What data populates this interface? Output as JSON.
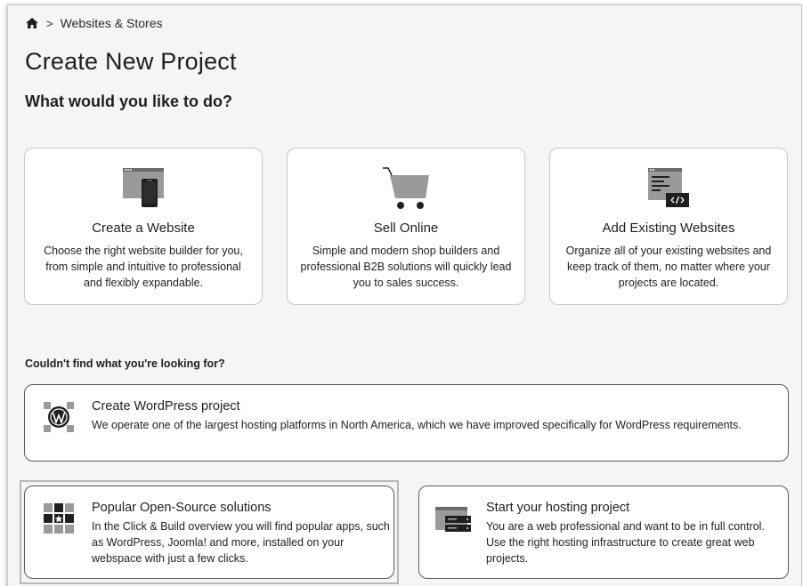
{
  "breadcrumb": {
    "home_icon": "home-icon",
    "separator": ">",
    "current": "Websites & Stores"
  },
  "page_title": "Create New Project",
  "subtitle": "What would you like to do?",
  "cards": [
    {
      "icon": "website-device-icon",
      "title": "Create a Website",
      "description": "Choose the right website builder for you, from simple and intuitive to professional and flexibly expandable."
    },
    {
      "icon": "shopping-cart-icon",
      "title": "Sell Online",
      "description": "Simple and modern shop builders and professional B2B solutions will quickly lead you to sales success."
    },
    {
      "icon": "code-document-icon",
      "title": "Add Existing Websites",
      "description": "Organize all of your existing websites and keep track of them, no matter where your projects are located."
    }
  ],
  "section_label": "Couldn't find what you're looking for?",
  "options": {
    "wordpress": {
      "icon": "wordpress-icon",
      "title": "Create WordPress project",
      "description": "We operate one of the largest hosting platforms in North America, which we have improved specifically for WordPress requirements."
    },
    "open_source": {
      "icon": "app-grid-icon",
      "title": "Popular Open-Source solutions",
      "description": "In the Click & Build overview you will find popular apps, such as WordPress, Joomla! and more, installed on your webspace with just a few clicks."
    },
    "hosting": {
      "icon": "server-icon",
      "title": "Start your hosting project",
      "description": "You are a web professional and want to be in full control. Use the right hosting infrastructure to create great web projects."
    }
  },
  "colors": {
    "background": "#f5f5f5",
    "card": "#ffffff",
    "icon_dark": "#1f1f1f",
    "icon_gray": "#9a9a9a"
  }
}
